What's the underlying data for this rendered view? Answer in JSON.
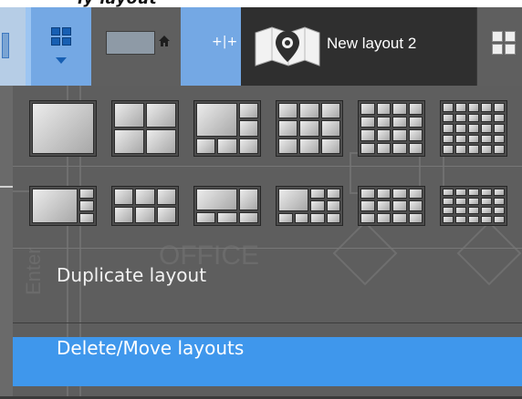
{
  "toolbar": {
    "layouts_button_icon": "layout-grid-icon",
    "layouts_button_arrow": "chevron-down-icon",
    "current_layout_icon": "home-icon",
    "expand_symbol": "+|+",
    "tab_label": "New layout 2",
    "tab_icon": "map-pin-icon",
    "more_icon": "layout-grid-icon"
  },
  "menu": {
    "layouts_row_1": [
      "1x1",
      "2x2",
      "3+4",
      "3x3",
      "4x4",
      "5x5"
    ],
    "layouts_row_2": [
      "1+4",
      "3x2",
      "3+2",
      "4x3 mixed",
      "4x3",
      "5x4"
    ],
    "actions": [
      {
        "label": "Duplicate layout",
        "highlighted": false
      },
      {
        "label": "Delete/Move layouts",
        "highlighted": true
      }
    ],
    "highlight_color": "#3f97ec"
  }
}
